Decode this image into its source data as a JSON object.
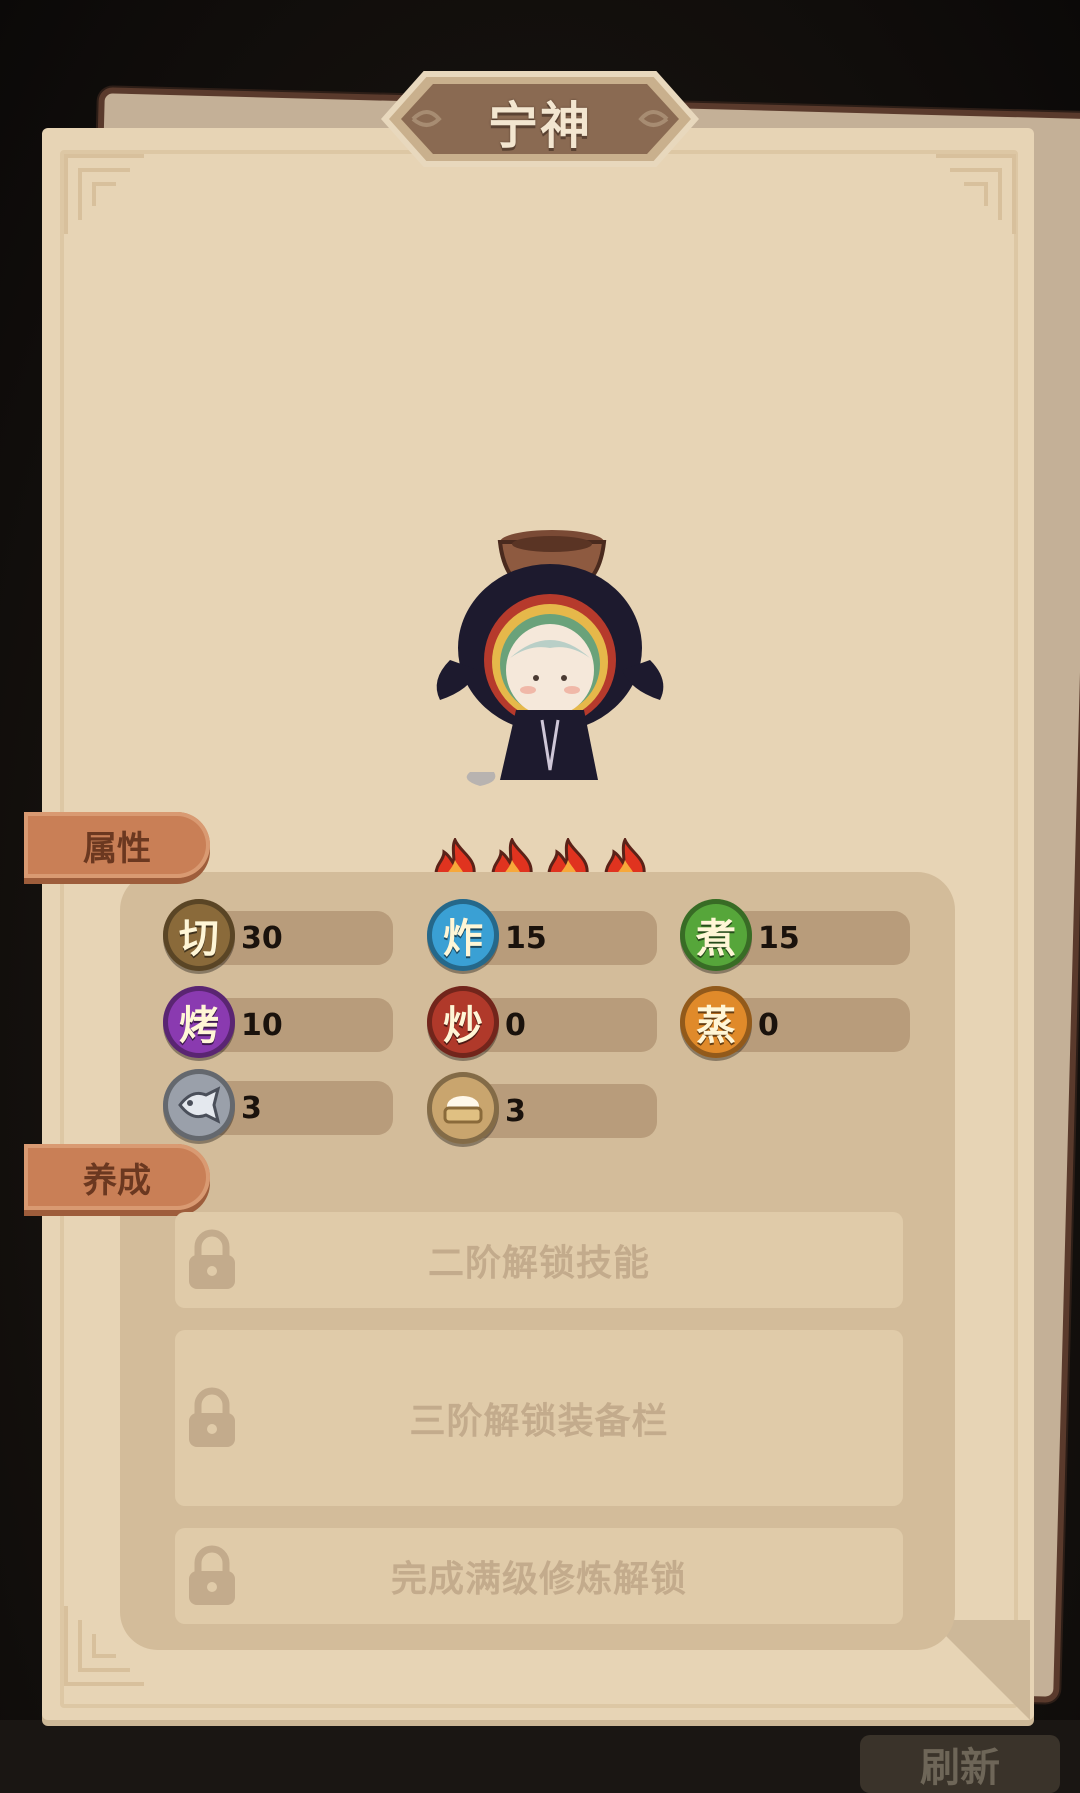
{
  "background": {
    "buttons": [
      "刷新"
    ]
  },
  "title": "宁神",
  "sections": {
    "attributes_tab": "属性",
    "training_tab": "养成"
  },
  "flames": {
    "count": 4,
    "max": 4
  },
  "stats": [
    {
      "label": "切",
      "value": "30",
      "color": "#8a6a3a",
      "icon": "cut-icon"
    },
    {
      "label": "炸",
      "value": "15",
      "color": "#3aa0d4",
      "icon": "fry-icon"
    },
    {
      "label": "煮",
      "value": "15",
      "color": "#56a63a",
      "icon": "boil-icon"
    },
    {
      "label": "烤",
      "value": "10",
      "color": "#8a3ab0",
      "icon": "roast-icon"
    },
    {
      "label": "炒",
      "value": "0",
      "color": "#b0392a",
      "icon": "stir-fry-icon"
    },
    {
      "label": "蒸",
      "value": "0",
      "color": "#e08a2a",
      "icon": "steam-icon"
    },
    {
      "label": "",
      "value": "3",
      "color": "#9aa0aa",
      "icon": "fish-icon"
    },
    {
      "label": "",
      "value": "3",
      "color": "#c9a56e",
      "icon": "bun-icon"
    }
  ],
  "unlocks": [
    {
      "text": "二阶解锁技能",
      "icon": "lock-icon"
    },
    {
      "text": "三阶解锁装备栏",
      "icon": "lock-icon"
    },
    {
      "text": "完成满级修炼解锁",
      "icon": "lock-icon"
    }
  ]
}
